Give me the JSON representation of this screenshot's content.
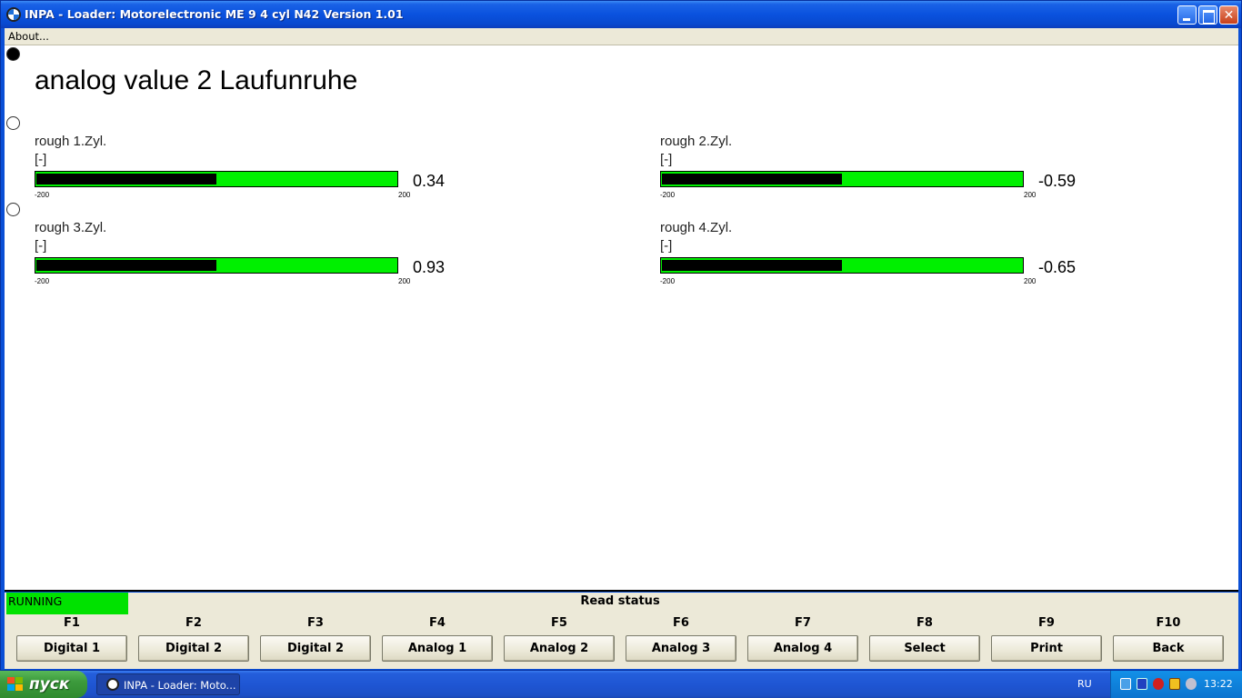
{
  "window": {
    "title": "INPA - Loader:  Motorelectronic ME 9  4 cyl N42 Version 1.01"
  },
  "menu": {
    "about": "About..."
  },
  "main": {
    "heading": "analog value 2 Laufunruhe",
    "measurements": [
      {
        "label": "rough 1.Zyl.",
        "unit": "[-]",
        "min": "-200",
        "max": "200",
        "value": "0.34",
        "level": 0.5
      },
      {
        "label": "rough 2.Zyl.",
        "unit": "[-]",
        "min": "-200",
        "max": "200",
        "value": "-0.59",
        "level": 0.5
      },
      {
        "label": "rough 3.Zyl.",
        "unit": "[-]",
        "min": "-200",
        "max": "200",
        "value": "0.93",
        "level": 0.5
      },
      {
        "label": "rough 4.Zyl.",
        "unit": "[-]",
        "min": "-200",
        "max": "200",
        "value": "-0.65",
        "level": 0.5
      }
    ]
  },
  "status": {
    "running": "RUNNING",
    "title": "Read status",
    "running_color": "#00e200"
  },
  "fkeys": [
    {
      "key": "F1",
      "label": "Digital 1"
    },
    {
      "key": "F2",
      "label": "Digital 2"
    },
    {
      "key": "F3",
      "label": "Digital 2"
    },
    {
      "key": "F4",
      "label": "Analog 1"
    },
    {
      "key": "F5",
      "label": "Analog 2"
    },
    {
      "key": "F6",
      "label": "Analog 3"
    },
    {
      "key": "F7",
      "label": "Analog 4"
    },
    {
      "key": "F8",
      "label": "Select"
    },
    {
      "key": "F9",
      "label": "Print"
    },
    {
      "key": "F10",
      "label": "Back"
    }
  ],
  "taskbar": {
    "start": "пуск",
    "task": "INPA - Loader:  Moto...",
    "lang": "RU",
    "time": "13:22"
  },
  "colors": {
    "bar_bg": "#00f000",
    "bar_fill": "#000000",
    "titlebar": "#0a52de"
  }
}
